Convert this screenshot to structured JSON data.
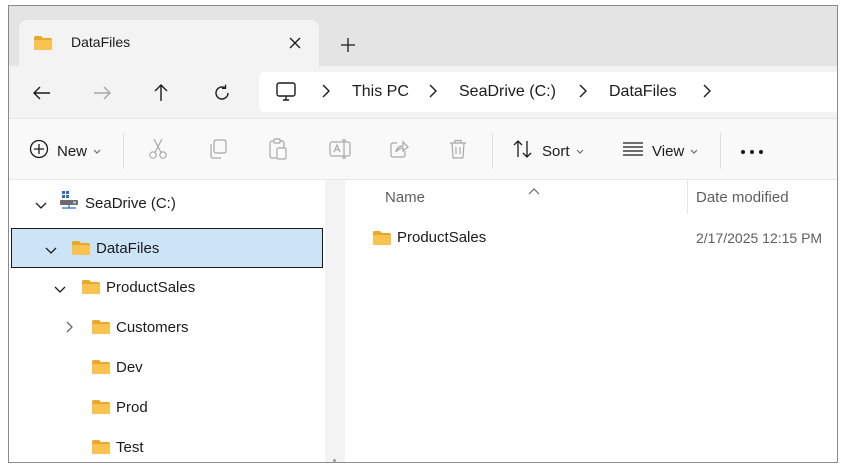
{
  "tab": {
    "title": "DataFiles",
    "folder_icon": "folder-icon",
    "close_icon": "close-icon"
  },
  "new_tab_icon": "plus-icon",
  "nav": {
    "back_icon": "arrow-left-icon",
    "forward_icon": "arrow-right-icon",
    "up_icon": "arrow-up-icon",
    "refresh_icon": "refresh-icon"
  },
  "breadcrumb": [
    "This PC",
    "SeaDrive (C:)",
    "DataFiles"
  ],
  "commands": {
    "new_label": "New",
    "sort_label": "Sort",
    "view_label": "View",
    "icons": [
      "cut-icon",
      "copy-icon",
      "paste-icon",
      "rename-icon",
      "share-icon",
      "delete-icon"
    ]
  },
  "tree": [
    {
      "label": "SeaDrive (C:)",
      "expanded": true,
      "selected": false
    },
    {
      "label": "DataFiles",
      "expanded": true,
      "selected": true
    },
    {
      "label": "ProductSales",
      "expanded": true,
      "selected": false
    },
    {
      "label": "Customers",
      "expanded": false,
      "selected": false
    },
    {
      "label": "Dev",
      "selected": false
    },
    {
      "label": "Prod",
      "selected": false
    },
    {
      "label": "Test",
      "selected": false
    }
  ],
  "columns": {
    "name": "Name",
    "date_modified": "Date modified"
  },
  "files": [
    {
      "name": "ProductSales",
      "date_modified": "2/17/2025 12:15 PM"
    }
  ],
  "colors": {
    "folder": "#f8c44f",
    "folder_dark": "#e8a92a",
    "selection": "#cce4f7",
    "accent": "#0067c0"
  }
}
